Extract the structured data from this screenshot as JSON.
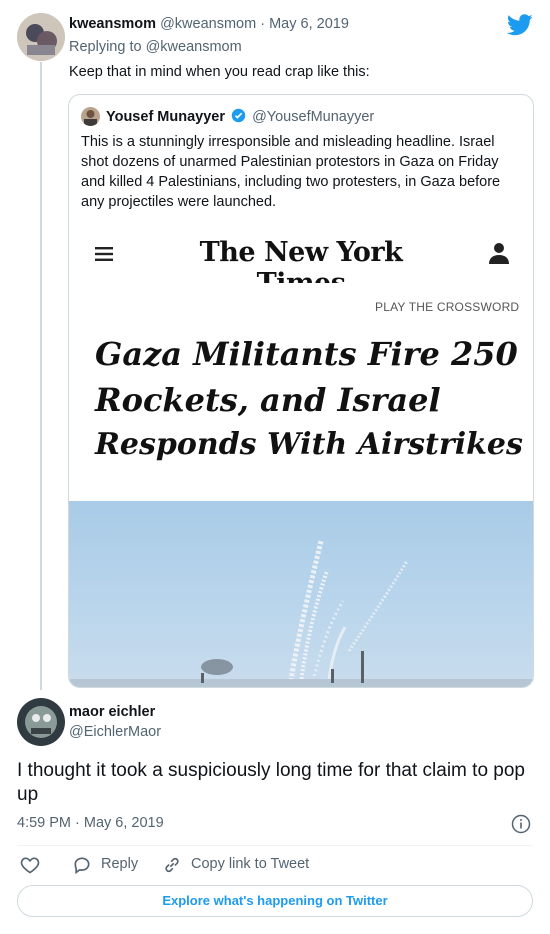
{
  "main_tweet": {
    "display_name": "kweansmom",
    "handle": "@kweansmom",
    "date": "May 6, 2019",
    "replying_prefix": "Replying to",
    "replying_handle": "@kweansmom",
    "text": "Keep that in mind when you read crap like this:"
  },
  "quoted_tweet": {
    "display_name": "Yousef Munayyer",
    "handle": "@YousefMunayyer",
    "text": "This is a stunningly irresponsible and misleading headline. Israel shot dozens of unarmed Palestinian protestors in Gaza on Friday and killed 4 Palestinians, including two protesters, in Gaza before any projectiles were launched."
  },
  "nyt": {
    "masthead": "The New York Times",
    "crossword_link": "PLAY THE CROSSWORD",
    "headline_lines": [
      "Gaza Militants Fire 250",
      "Rockets, and Israel",
      "Responds With Airstrikes"
    ]
  },
  "reply_tweet": {
    "display_name": "maor eichler",
    "handle": "@EichlerMaor",
    "text": "I thought it took a suspiciously long time for that claim to pop up",
    "timestamp": "4:59 PM · May 6, 2019"
  },
  "actions": {
    "reply_label": "Reply",
    "copy_link_label": "Copy link to Tweet"
  },
  "explore_button": "Explore what's happening on Twitter",
  "colors": {
    "twitter_blue": "#1d9bf0",
    "verified_blue": "#1d9bf0",
    "muted_text": "#536471",
    "border": "#cfd9de"
  }
}
